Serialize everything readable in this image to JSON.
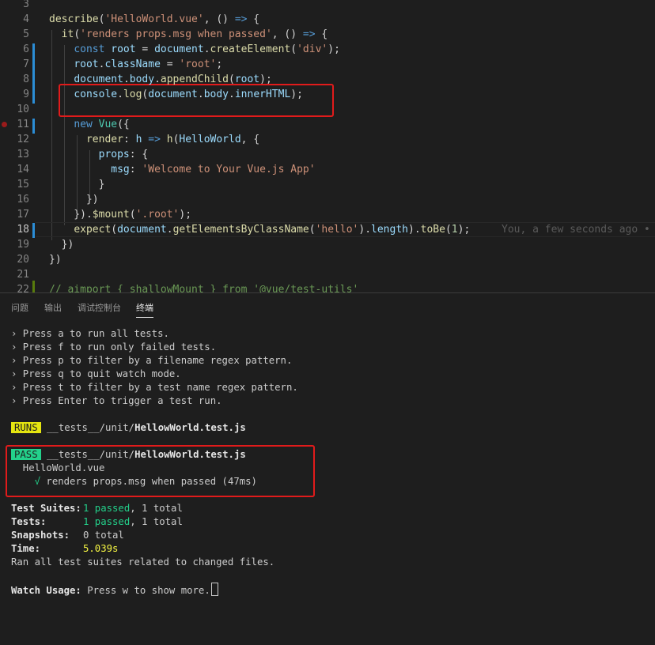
{
  "editor": {
    "blame": "You, a few seconds ago •",
    "lines": [
      {
        "n": "3",
        "tokens": []
      },
      {
        "n": "4",
        "tokens": [
          {
            "c": "f",
            "t": "describe"
          },
          {
            "t": "("
          },
          {
            "c": "s",
            "t": "'HelloWorld.vue'"
          },
          {
            "t": ", () "
          },
          {
            "c": "k",
            "t": "=>"
          },
          {
            "t": " {"
          }
        ]
      },
      {
        "n": "5",
        "tokens": [
          {
            "t": "  "
          },
          {
            "c": "f",
            "t": "it"
          },
          {
            "t": "("
          },
          {
            "c": "s",
            "t": "'renders props.msg when passed'"
          },
          {
            "t": ", () "
          },
          {
            "c": "k",
            "t": "=>"
          },
          {
            "t": " {"
          }
        ]
      },
      {
        "n": "6",
        "tokens": [
          {
            "t": "    "
          },
          {
            "c": "k",
            "t": "const"
          },
          {
            "t": " "
          },
          {
            "c": "v",
            "t": "root"
          },
          {
            "t": " = "
          },
          {
            "c": "v",
            "t": "document"
          },
          {
            "t": "."
          },
          {
            "c": "f",
            "t": "createElement"
          },
          {
            "t": "("
          },
          {
            "c": "s",
            "t": "'div'"
          },
          {
            "t": ");"
          }
        ]
      },
      {
        "n": "7",
        "tokens": [
          {
            "t": "    "
          },
          {
            "c": "v",
            "t": "root"
          },
          {
            "t": "."
          },
          {
            "c": "v",
            "t": "className"
          },
          {
            "t": " = "
          },
          {
            "c": "s",
            "t": "'root'"
          },
          {
            "t": ";"
          }
        ]
      },
      {
        "n": "8",
        "tokens": [
          {
            "t": "    "
          },
          {
            "c": "v",
            "t": "document"
          },
          {
            "t": "."
          },
          {
            "c": "v",
            "t": "body"
          },
          {
            "t": "."
          },
          {
            "c": "f",
            "t": "appendChild"
          },
          {
            "t": "("
          },
          {
            "c": "v",
            "t": "root"
          },
          {
            "t": ");"
          }
        ]
      },
      {
        "n": "9",
        "tokens": [
          {
            "t": "    "
          },
          {
            "c": "v",
            "t": "console"
          },
          {
            "t": "."
          },
          {
            "c": "f",
            "t": "log"
          },
          {
            "t": "("
          },
          {
            "c": "v",
            "t": "document"
          },
          {
            "t": "."
          },
          {
            "c": "v",
            "t": "body"
          },
          {
            "t": "."
          },
          {
            "c": "v",
            "t": "innerHTML"
          },
          {
            "t": ");"
          }
        ]
      },
      {
        "n": "10",
        "tokens": []
      },
      {
        "n": "11",
        "tokens": [
          {
            "t": "    "
          },
          {
            "c": "k",
            "t": "new"
          },
          {
            "t": " "
          },
          {
            "c": "t",
            "t": "Vue"
          },
          {
            "t": "({"
          }
        ]
      },
      {
        "n": "12",
        "tokens": [
          {
            "t": "      "
          },
          {
            "c": "f",
            "t": "render"
          },
          {
            "t": ": "
          },
          {
            "c": "v",
            "t": "h"
          },
          {
            "t": " "
          },
          {
            "c": "k",
            "t": "=>"
          },
          {
            "t": " "
          },
          {
            "c": "f",
            "t": "h"
          },
          {
            "t": "("
          },
          {
            "c": "v",
            "t": "HelloWorld"
          },
          {
            "t": ", {"
          }
        ]
      },
      {
        "n": "13",
        "tokens": [
          {
            "t": "        "
          },
          {
            "c": "v",
            "t": "props"
          },
          {
            "t": ": {"
          }
        ]
      },
      {
        "n": "14",
        "tokens": [
          {
            "t": "          "
          },
          {
            "c": "v",
            "t": "msg"
          },
          {
            "t": ": "
          },
          {
            "c": "s",
            "t": "'Welcome to Your Vue.js App'"
          }
        ]
      },
      {
        "n": "15",
        "tokens": [
          {
            "t": "        }"
          }
        ]
      },
      {
        "n": "16",
        "tokens": [
          {
            "t": "      })"
          }
        ]
      },
      {
        "n": "17",
        "tokens": [
          {
            "t": "    })."
          },
          {
            "c": "f",
            "t": "$mount"
          },
          {
            "t": "("
          },
          {
            "c": "s",
            "t": "'.root'"
          },
          {
            "t": ");"
          }
        ]
      },
      {
        "n": "18",
        "tokens": [
          {
            "t": "    "
          },
          {
            "c": "f",
            "t": "expect"
          },
          {
            "t": "("
          },
          {
            "c": "v",
            "t": "document"
          },
          {
            "t": "."
          },
          {
            "c": "f",
            "t": "getElementsByClassName"
          },
          {
            "t": "("
          },
          {
            "c": "s",
            "t": "'hello'"
          },
          {
            "t": ")."
          },
          {
            "c": "v",
            "t": "length"
          },
          {
            "t": ")."
          },
          {
            "c": "f",
            "t": "toBe"
          },
          {
            "t": "("
          },
          {
            "c": "n",
            "t": "1"
          },
          {
            "t": ");"
          }
        ]
      },
      {
        "n": "19",
        "tokens": [
          {
            "t": "  })"
          }
        ]
      },
      {
        "n": "20",
        "tokens": [
          {
            "t": "})"
          }
        ]
      },
      {
        "n": "21",
        "tokens": []
      },
      {
        "n": "22",
        "tokens": [
          {
            "c": "c",
            "t": "// aimport { shallowMount } from '@vue/test-utils'"
          }
        ]
      }
    ]
  },
  "panel": {
    "tabs": [
      "问题",
      "输出",
      "调试控制台",
      "终端"
    ],
    "active_tab": "终端"
  },
  "terminal": {
    "usage": [
      "› Press a to run all tests.",
      "› Press f to run only failed tests.",
      "› Press p to filter by a filename regex pattern.",
      "› Press q to quit watch mode.",
      "› Press t to filter by a test name regex pattern.",
      "› Press Enter to trigger a test run."
    ],
    "runs_badge": "RUNS",
    "pass_badge": "PASS",
    "test_dir": " __tests__/unit/",
    "test_file": "HellowWorld.test.js",
    "suite_name": "  HelloWorld.vue",
    "check_mark": "    √",
    "test_result": " renders props.msg when passed (47ms)",
    "summary": [
      {
        "label": "Test Suites:",
        "value": "1 passed",
        "rest": ", 1 total",
        "color": "g"
      },
      {
        "label": "Tests:",
        "value": "1 passed",
        "rest": ", 1 total",
        "color": "g"
      },
      {
        "label": "Snapshots:",
        "value": "0 total",
        "rest": "",
        "color": ""
      },
      {
        "label": "Time:",
        "value": "5.039s",
        "rest": "",
        "color": "y"
      }
    ],
    "ran_line": "Ran all test suites related to changed files.",
    "watch_label": "Watch Usage:",
    "watch_text": " Press w to show more."
  }
}
